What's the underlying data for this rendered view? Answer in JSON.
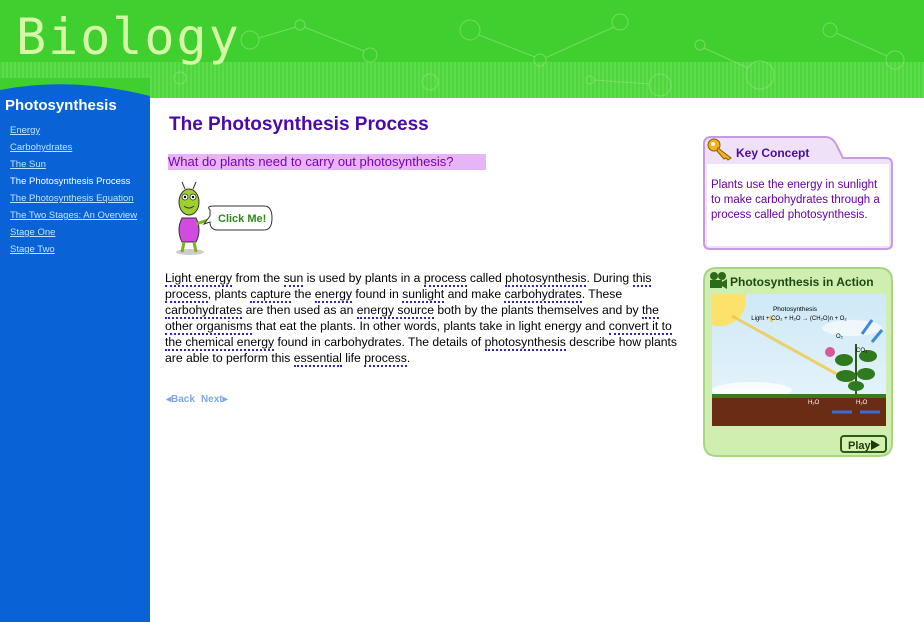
{
  "header": {
    "title": "Biology"
  },
  "sidebar": {
    "heading": "Photosynthesis",
    "items": [
      {
        "label": "Energy"
      },
      {
        "label": "Carbohydrates"
      },
      {
        "label": "The Sun"
      },
      {
        "label": "The Photosynthesis Process",
        "current": true
      },
      {
        "label": "The Photosynthesis Equation"
      },
      {
        "label": "The Two Stages: An Overview"
      },
      {
        "label": "Stage One"
      },
      {
        "label": "Stage Two"
      }
    ]
  },
  "main": {
    "title": "The Photosynthesis Process",
    "question": "What do plants need to carry out photosynthesis?",
    "clickme": "Click Me!",
    "body": [
      {
        "t": "Light energy",
        "term": true
      },
      {
        "t": " from the "
      },
      {
        "t": "sun",
        "term": true
      },
      {
        "t": " is used by plants in a "
      },
      {
        "t": "process",
        "term": true
      },
      {
        "t": " called "
      },
      {
        "t": "photosynthesis",
        "term": true
      },
      {
        "t": ". During "
      },
      {
        "t": "this process",
        "term": true
      },
      {
        "t": ", plants "
      },
      {
        "t": "capture",
        "term": true
      },
      {
        "t": " the "
      },
      {
        "t": "energy",
        "term": true
      },
      {
        "t": " found in "
      },
      {
        "t": "sunlight",
        "term": true
      },
      {
        "t": " and make "
      },
      {
        "t": "carbohydrates",
        "term": true
      },
      {
        "t": ". These "
      },
      {
        "t": "carbohydrates",
        "term": true
      },
      {
        "t": " are then used as an "
      },
      {
        "t": "energy source",
        "term": true
      },
      {
        "t": " both by the plants themselves and by "
      },
      {
        "t": "the other organisms",
        "term": true
      },
      {
        "t": " that eat the plants. In other words, plants take in light energy and "
      },
      {
        "t": "convert it to the chemical energy",
        "term": true
      },
      {
        "t": " found in carbohydrates. The details of "
      },
      {
        "t": "photosynthesis",
        "term": true
      },
      {
        "t": " describe how plants are able to perform this "
      },
      {
        "t": "essential",
        "term": true
      },
      {
        "t": " life "
      },
      {
        "t": "process",
        "term": true
      },
      {
        "t": "."
      }
    ],
    "back": "◂Back",
    "next": "Next▸"
  },
  "key_concept": {
    "title": "Key Concept",
    "text": "Plants use the energy in sunlight to make carbohydrates through a process called photosynthesis."
  },
  "action": {
    "title": "Photosynthesis in Action",
    "scene_title": "Photosynthesis",
    "equation": "Light + CO₂ + H₂O → (CH₂O)n + O₂",
    "o2": "O₂",
    "co2": "CO₂",
    "h2o_left": "H₂O",
    "h2o_right": "H₂O",
    "play": "Play"
  },
  "colors": {
    "header_green": "#3fcf2f",
    "sidebar_blue": "#0a63d6",
    "title_purple": "#4a0aa6",
    "question_bg": "#e7b4f5"
  }
}
